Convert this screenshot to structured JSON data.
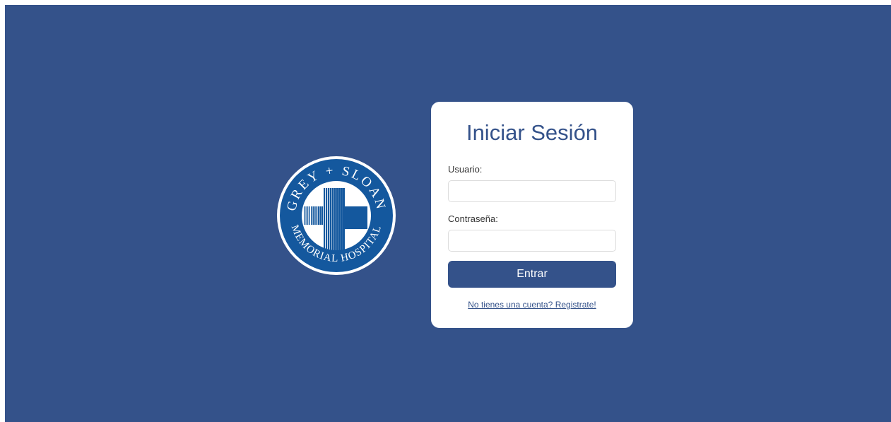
{
  "logo": {
    "top_text": "GREY + SLOAN",
    "bottom_text": "MEMORIAL HOSPITAL",
    "colors": {
      "ring": "#14589e",
      "cross": "#14589e",
      "background": "#ffffff"
    }
  },
  "login": {
    "title": "Iniciar Sesión",
    "username_label": "Usuario:",
    "username_value": "",
    "password_label": "Contraseña:",
    "password_value": "",
    "submit_label": "Entrar",
    "register_link": "No tienes una cuenta? Registrate!"
  },
  "colors": {
    "background": "#34528a",
    "accent": "#34528a",
    "card": "#ffffff"
  }
}
